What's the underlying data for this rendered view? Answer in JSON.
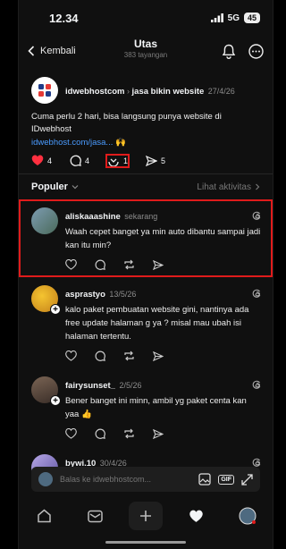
{
  "status": {
    "time": "12.34",
    "network": "5G",
    "battery": "45"
  },
  "header": {
    "back_label": "Kembali",
    "title": "Utas",
    "views": "383 tayangan"
  },
  "post": {
    "username": "idwebhostcom",
    "separator": " › ",
    "topic": "jasa bikin website",
    "date": "27/4/26",
    "text": "Cuma perlu 2 hari, bisa langsung punya website di IDwebhost",
    "link": "idwebhost.com/jasa...",
    "link_emoji": "🙌",
    "likes": "4",
    "comments": "4",
    "reposts": "1",
    "shares": "5"
  },
  "tabs": {
    "left": "Populer",
    "right": "Lihat aktivitas"
  },
  "replies": [
    {
      "username": "aliskaaashine",
      "time": "sekarang",
      "text": "Waah cepet banget ya min auto dibantu sampai jadi kan itu min?",
      "avatar_color": "#6b8aa0"
    },
    {
      "username": "asprastyo",
      "time": "13/5/26",
      "text": "kalo paket pembuatan website gini, nantinya ada free update halaman g ya ? misal mau ubah isi halaman tertentu.",
      "avatar_color": "#d9a441"
    },
    {
      "username": "fairysunset_",
      "time": "2/5/26",
      "text": "Bener banget ini minn, ambil yg paket centa kan yaa 👍",
      "avatar_color": "#5a4a42"
    },
    {
      "username": "bywi.10",
      "time": "30/4/26",
      "text": "",
      "avatar_color": "#8a7fc0"
    }
  ],
  "composer": {
    "placeholder": "Balas ke idwebhostcom..."
  },
  "colors": {
    "highlight": "#e01b1b",
    "link": "#4a9bff",
    "like": "#ff3040"
  }
}
